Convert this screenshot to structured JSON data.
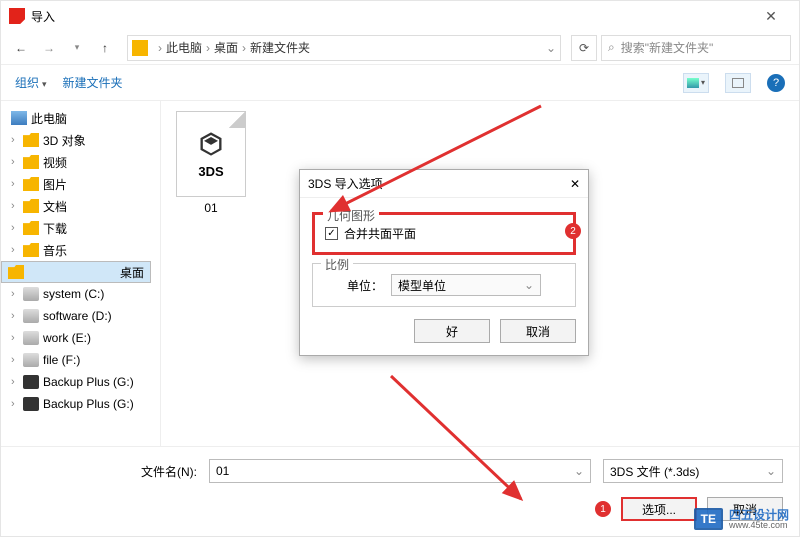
{
  "titlebar": {
    "title": "导入"
  },
  "nav": {
    "crumbs": [
      "此电脑",
      "桌面",
      "新建文件夹"
    ],
    "search_placeholder": "搜索\"新建文件夹\""
  },
  "toolbar": {
    "organize": "组织",
    "newfolder": "新建文件夹",
    "help": "?"
  },
  "sidebar": {
    "items": [
      {
        "label": "此电脑",
        "icon": "pc",
        "root": true,
        "chev": false
      },
      {
        "label": "3D 对象",
        "icon": "folder",
        "chev": true
      },
      {
        "label": "视频",
        "icon": "folder",
        "chev": true
      },
      {
        "label": "图片",
        "icon": "folder",
        "chev": true
      },
      {
        "label": "文档",
        "icon": "folder",
        "chev": true
      },
      {
        "label": "下载",
        "icon": "folder",
        "chev": true
      },
      {
        "label": "音乐",
        "icon": "folder",
        "chev": true
      },
      {
        "label": "桌面",
        "icon": "folder",
        "chev": true,
        "selected": true
      },
      {
        "label": "system (C:)",
        "icon": "drive",
        "chev": true
      },
      {
        "label": "software (D:)",
        "icon": "drive",
        "chev": true
      },
      {
        "label": "work (E:)",
        "icon": "drive",
        "chev": true
      },
      {
        "label": "file (F:)",
        "icon": "drive",
        "chev": true
      },
      {
        "label": "Backup Plus (G:)",
        "icon": "ext",
        "chev": true
      },
      {
        "label": "Backup Plus (G:)",
        "icon": "ext",
        "chev": true
      }
    ]
  },
  "files": {
    "items": [
      {
        "ext": "3DS",
        "name": "01"
      }
    ]
  },
  "bottom": {
    "filename_label": "文件名(N):",
    "filename_value": "01",
    "filetype": "3DS 文件 (*.3ds)",
    "options_btn": "选项...",
    "cancel_btn": "取消"
  },
  "dialog": {
    "title": "3DS 导入选项",
    "geom_group": "几何图形",
    "merge_label": "合并共面平面",
    "scale_group": "比例",
    "unit_label": "单位：",
    "unit_value": "模型单位",
    "ok": "好",
    "cancel": "取消"
  },
  "badges": {
    "one": "1",
    "two": "2"
  },
  "watermark": {
    "logo": "TE",
    "name": "四五设计网",
    "url": "www.45te.com"
  }
}
